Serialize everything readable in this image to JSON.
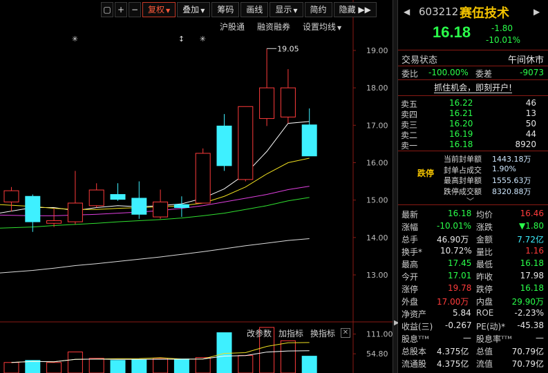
{
  "toolbar": {
    "lock_icon": "lock-icon",
    "plus_label": "+",
    "minus_label": "−",
    "adjust_label": "复权",
    "overlay_label": "叠加",
    "chips_label": "筹码",
    "draw_label": "画线",
    "display_label": "显示",
    "simple_label": "简约",
    "hide_label": "隐藏",
    "more_label": "▶▶"
  },
  "sublinks": {
    "hk_connect": "沪股通",
    "margin": "融资融券",
    "ma_settings": "设置均线"
  },
  "volume_toolbar": {
    "change_params": "改参数",
    "add_indicator": "加指标",
    "switch_indicator": "换指标",
    "close_label": "✕"
  },
  "chart_data": {
    "type": "candlestick",
    "ylim": [
      12.7,
      19.35
    ],
    "y_ticks": [
      "19.00",
      "18.00",
      "17.00",
      "16.00",
      "15.00",
      "14.00",
      "13.00"
    ],
    "y_tick_values": [
      19,
      18,
      17,
      16,
      15,
      14,
      13
    ],
    "high_annotation": "19.05",
    "high_value": 19.05,
    "markers": [
      "✳",
      "↕",
      "✳"
    ],
    "candles": [
      {
        "o": 14.95,
        "c": 15.25,
        "h": 15.35,
        "l": 14.7,
        "up": true
      },
      {
        "o": 15.1,
        "c": 14.42,
        "h": 15.15,
        "l": 14.15,
        "up": false
      },
      {
        "o": 14.38,
        "c": 14.45,
        "h": 14.78,
        "l": 14.28,
        "up": true
      },
      {
        "o": 14.42,
        "c": 14.92,
        "h": 15.78,
        "l": 14.35,
        "up": true
      },
      {
        "o": 14.85,
        "c": 15.27,
        "h": 15.45,
        "l": 14.8,
        "up": true
      },
      {
        "o": 15.15,
        "c": 15.02,
        "h": 15.45,
        "l": 14.98,
        "up": false
      },
      {
        "o": 15.05,
        "c": 14.62,
        "h": 15.5,
        "l": 14.5,
        "up": false
      },
      {
        "o": 14.55,
        "c": 14.95,
        "h": 15.28,
        "l": 14.5,
        "up": true
      },
      {
        "o": 14.88,
        "c": 14.8,
        "h": 15.1,
        "l": 14.55,
        "up": false
      },
      {
        "o": 14.92,
        "c": 16.25,
        "h": 16.38,
        "l": 14.92,
        "up": true
      },
      {
        "o": 16.98,
        "c": 15.92,
        "h": 17.3,
        "l": 15.78,
        "up": false
      },
      {
        "o": 15.55,
        "c": 17.5,
        "h": 17.5,
        "l": 15.5,
        "up": true
      },
      {
        "o": 17.18,
        "c": 18.0,
        "h": 19.05,
        "l": 16.98,
        "up": true
      },
      {
        "o": 17.22,
        "c": 18.0,
        "h": 18.5,
        "l": 17.05,
        "up": true
      },
      {
        "o": 17.01,
        "c": 16.18,
        "h": 17.45,
        "l": 16.18,
        "up": false
      }
    ],
    "ma_series": [
      {
        "color": "#ffffff",
        "values": [
          14.65,
          14.8,
          14.8,
          14.72,
          14.8,
          14.85,
          14.82,
          14.85,
          14.9,
          15.05,
          15.3,
          15.7,
          16.3,
          17.05,
          17.1
        ]
      },
      {
        "color": "#f0e020",
        "values": [
          14.88,
          14.83,
          14.78,
          14.75,
          14.75,
          14.78,
          14.8,
          14.82,
          14.85,
          14.92,
          15.1,
          15.35,
          15.7,
          16.0,
          16.12
        ]
      },
      {
        "color": "#e040e0",
        "values": [
          14.6,
          14.58,
          14.58,
          14.6,
          14.62,
          14.65,
          14.68,
          14.72,
          14.78,
          14.85,
          14.95,
          15.05,
          15.15,
          15.28,
          15.37
        ]
      },
      {
        "color": "#30e030",
        "values": [
          14.25,
          14.28,
          14.32,
          14.35,
          14.38,
          14.42,
          14.45,
          14.48,
          14.52,
          14.58,
          14.65,
          14.75,
          14.85,
          14.98,
          15.07
        ]
      },
      {
        "color": "#dddddd",
        "values": [
          13.05,
          13.12,
          13.18,
          13.25,
          13.3,
          13.36,
          13.42,
          13.48,
          13.55,
          13.62,
          13.7,
          13.78,
          13.85,
          13.92,
          13.97
        ]
      }
    ],
    "volume": {
      "y_ticks": [
        "111.00",
        "54.80"
      ],
      "y_tick_values": [
        111.0,
        54.8
      ],
      "ylim": [
        0,
        130
      ],
      "values": [
        30,
        36,
        30,
        60,
        42,
        36,
        38,
        42,
        40,
        44,
        115,
        50,
        130,
        92,
        48
      ],
      "up": [
        true,
        false,
        true,
        true,
        true,
        false,
        false,
        true,
        false,
        true,
        false,
        true,
        true,
        true,
        false
      ]
    }
  },
  "quote": {
    "code": "603212",
    "name": "赛伍技术",
    "right_icon": "grid-icon",
    "price": "16.18",
    "change": "-1.80",
    "change_pct": "-10.01%",
    "status_label": "交易状态",
    "status_value": "午间休市",
    "wb_label": "委比",
    "wb_value": "-100.00%",
    "wc_label": "委差",
    "wc_value": "-9073",
    "promo": "抓住机会，即刻开户!"
  },
  "orderbook": [
    {
      "name": "卖五",
      "price": "16.22",
      "vol": "46"
    },
    {
      "name": "卖四",
      "price": "16.21",
      "vol": "13"
    },
    {
      "name": "卖三",
      "price": "16.20",
      "vol": "50"
    },
    {
      "name": "卖二",
      "price": "16.19",
      "vol": "44"
    },
    {
      "name": "卖一",
      "price": "16.18",
      "vol": "8920"
    }
  ],
  "limit": {
    "tag": "跌停",
    "rows": [
      {
        "k": "当前封单额",
        "v": "1443.18万"
      },
      {
        "k": "封单占成交",
        "v": "1.90%"
      },
      {
        "k": "最高封单额",
        "v": "1555.63万"
      },
      {
        "k": "跌停成交额",
        "v": "8320.88万"
      }
    ]
  },
  "stats": {
    "latest_l": "最新",
    "latest_v": "16.18",
    "avg_l": "均价",
    "avg_v": "16.46",
    "chgp_l": "涨幅",
    "chgp_v": "-10.01%",
    "chg_l": "涨跌",
    "chg_v": "▼1.80",
    "vol_l": "总手",
    "vol_v": "46.90万",
    "amt_l": "金额",
    "amt_v": "7.72亿",
    "turn_l": "换手*",
    "turn_v": "10.72%",
    "vr_l": "量比",
    "vr_v": "1.16",
    "high_l": "最高",
    "high_v": "17.45",
    "low_l": "最低",
    "low_v": "16.18",
    "open_l": "今开",
    "open_v": "17.01",
    "prev_l": "昨收",
    "prev_v": "17.98",
    "up_l": "涨停",
    "up_v": "19.78",
    "down_l": "跌停",
    "down_v": "16.18",
    "out_l": "外盘",
    "out_v": "17.00万",
    "in_l": "内盘",
    "in_v": "29.90万",
    "nav_l": "净资产",
    "nav_v": "5.84",
    "roe_l": "ROE",
    "roe_v": "-2.23%",
    "eps_l": "收益(三)",
    "eps_v": "-0.267",
    "pe_l": "PE(动)*",
    "pe_v": "-45.38",
    "div_l": "股息ᵀᵀᴹ",
    "div_v": "—",
    "divr_l": "股息率ᵀᵀᴹ",
    "divr_v": "—",
    "tshare_l": "总股本",
    "tshare_v": "4.375亿",
    "mcap_l": "总值",
    "mcap_v": "70.79亿",
    "fshare_l": "流通股",
    "fshare_v": "4.375亿",
    "fcap_l": "流值",
    "fcap_v": "70.79亿"
  }
}
